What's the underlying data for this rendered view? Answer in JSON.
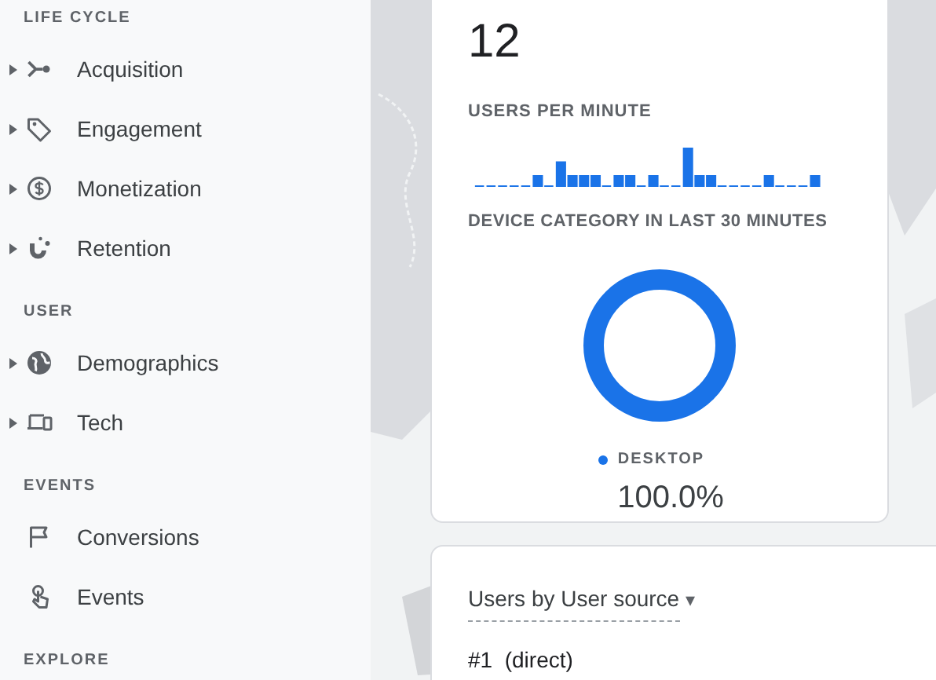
{
  "sidebar": {
    "sections": [
      {
        "title": "LIFE CYCLE",
        "items": [
          {
            "label": "Acquisition",
            "expandable": true
          },
          {
            "label": "Engagement",
            "expandable": true
          },
          {
            "label": "Monetization",
            "expandable": true
          },
          {
            "label": "Retention",
            "expandable": true
          }
        ]
      },
      {
        "title": "USER",
        "items": [
          {
            "label": "Demographics",
            "expandable": true
          },
          {
            "label": "Tech",
            "expandable": true
          }
        ]
      },
      {
        "title": "EVENTS",
        "items": [
          {
            "label": "Conversions",
            "expandable": false
          },
          {
            "label": "Events",
            "expandable": false
          }
        ]
      },
      {
        "title": "EXPLORE"
      }
    ]
  },
  "realtime_card": {
    "users_count": "12",
    "users_per_minute_title": "USERS PER MINUTE",
    "device_title": "DEVICE CATEGORY IN LAST 30 MINUTES",
    "legend": [
      {
        "label": "DESKTOP",
        "value": "100.0%",
        "color": "#1a73e8"
      }
    ]
  },
  "source_card": {
    "dimension_picker": "Users by User source",
    "caret": "▾",
    "first_row": "#1  (direct)"
  }
}
